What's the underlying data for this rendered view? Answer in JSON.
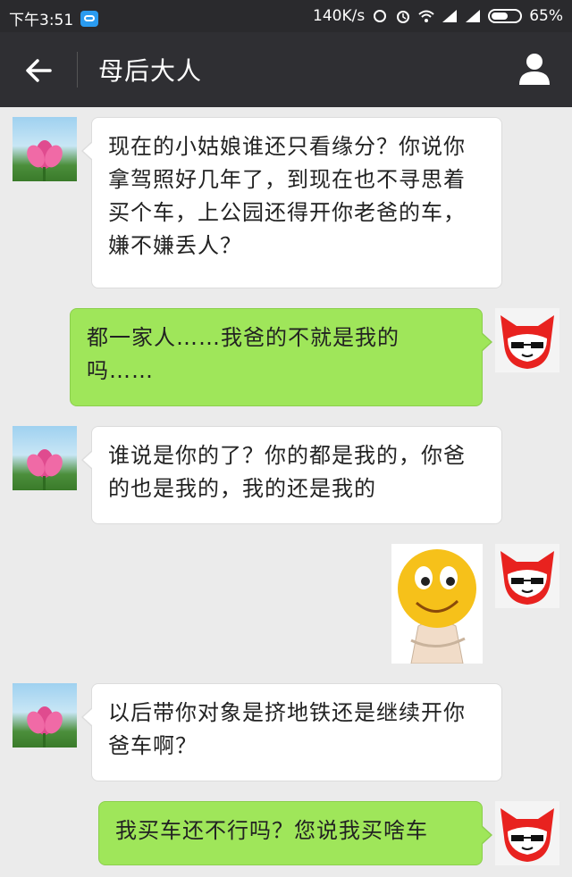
{
  "status_bar": {
    "time": "下午3:51",
    "speed": "140K/s",
    "battery": "65%"
  },
  "header": {
    "title": "母后大人"
  },
  "messages": [
    {
      "side": "in",
      "text": "现在的小姑娘谁还只看缘分？你说你拿驾照好几年了，到现在也不寻思着买个车，上公园还得开你老爸的车，嫌不嫌丢人？"
    },
    {
      "side": "out",
      "text": "都一家人……我爸的不就是我的吗……"
    },
    {
      "side": "in",
      "text": "谁说是你的了？你的都是我的，你爸的也是我的，我的还是我的"
    },
    {
      "side": "out",
      "sticker": "smiley-arms-crossed"
    },
    {
      "side": "in",
      "text": "以后带你对象是挤地铁还是继续开你爸车啊？"
    },
    {
      "side": "out",
      "text": "我买车还不行吗？您说我买啥车"
    }
  ],
  "colors": {
    "header_bg": "#2f2f33",
    "chat_bg": "#ebebeb",
    "out_bubble": "#9fe65a",
    "in_bubble": "#ffffff"
  }
}
